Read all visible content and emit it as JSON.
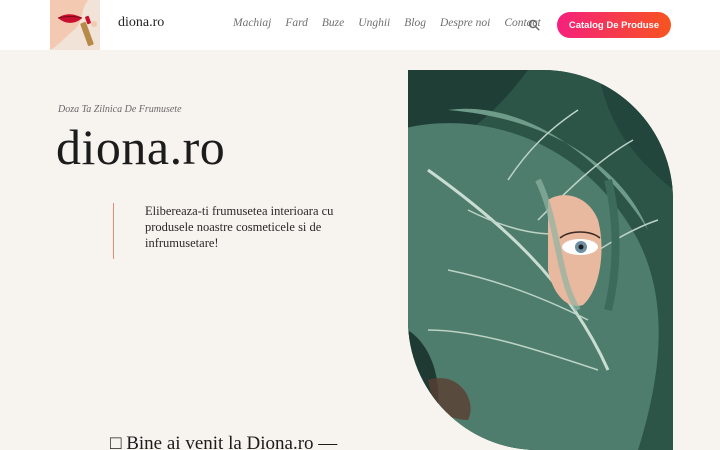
{
  "header": {
    "logo_text": "diona.ro",
    "nav": [
      "Machiaj",
      "Fard",
      "Buze",
      "Unghii",
      "Blog",
      "Despre noi",
      "Contact"
    ],
    "cta_label": "Catalog De Produse"
  },
  "hero": {
    "tagline": "Doza Ta Zilnica De Frumusete",
    "title": "diona.ro",
    "quote": "Elibereaza-ti frumusetea interioara cu produsele noastre cosmeticele si de infrumusetare!"
  },
  "welcome": {
    "text": "□ Bine ai venit la Diona.ro —"
  },
  "colors": {
    "background": "#f7f3ef",
    "accent_start": "#f6207d",
    "accent_end": "#f7541f",
    "quote_bar": "#e48a7d"
  },
  "icons": [
    "search-icon"
  ]
}
